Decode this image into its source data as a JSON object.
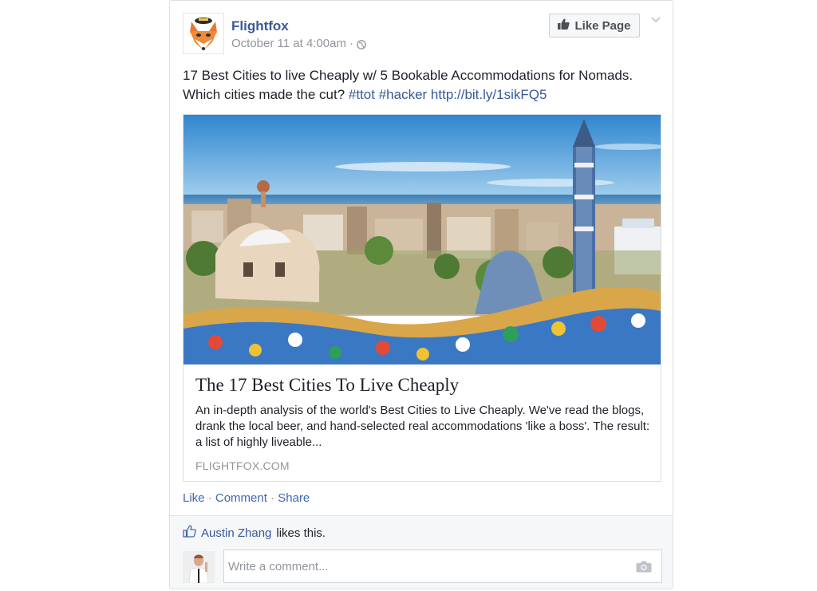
{
  "post": {
    "page_name": "Flightfox",
    "timestamp": "October 11 at 4:00am",
    "separator": "·",
    "privacy_icon": "globe-icon",
    "like_page_label": "Like Page",
    "menu_icon": "chevron-down-icon",
    "text_line1": "17 Best Cities to live Cheaply w/ 5 Bookable Accommodations for Nomads.",
    "text_line2_prefix": "Which cities made the cut? ",
    "hashtag1": "#ttot",
    "hashtag2": "#hacker",
    "url": "http://bit.ly/1sikFQ5"
  },
  "link_card": {
    "title": "The 17 Best Cities To Live Cheaply",
    "description": "An in-depth analysis of the world's Best Cities to Live Cheaply. We've read the blogs, drank the local beer, and hand-selected real accommodations 'like a boss'. The result: a list of highly liveable...",
    "domain": "FLIGHTFOX.COM"
  },
  "actions": {
    "like": "Like",
    "comment": "Comment",
    "share": "Share",
    "dot": " · "
  },
  "likes": {
    "icon": "thumbs-up-icon",
    "name": "Austin Zhang",
    "suffix": "likes this."
  },
  "comment_box": {
    "placeholder": "Write a comment...",
    "camera_icon": "camera-icon"
  },
  "colors": {
    "link_blue": "#365899",
    "page_name_blue": "#3b5998",
    "meta_gray": "#90949c",
    "footer_bg": "#f6f7f9"
  }
}
